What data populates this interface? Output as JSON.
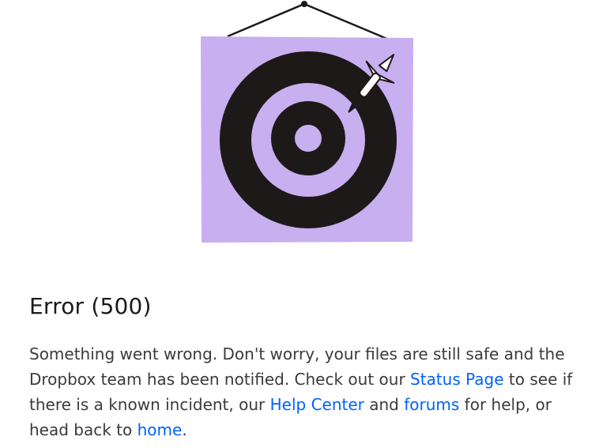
{
  "illustration": {
    "name": "target with dart",
    "background_color": "#c8aff0",
    "ring_color": "#1e1919"
  },
  "error": {
    "title": "Error (500)",
    "message_part1": "Something went wrong. Don't worry, your files are still safe and the Dropbox team has been notified. Check out our ",
    "status_link": "Status Page",
    "message_part2": " to see if there is a known incident, our ",
    "help_link": "Help Center",
    "message_part3": " and ",
    "forums_link": "forums",
    "message_part4": " for help, or head back to ",
    "home_link": "home",
    "message_part5": "."
  },
  "colors": {
    "link": "#0061fe",
    "text": "#3d3a38",
    "heading": "#1e1919"
  }
}
